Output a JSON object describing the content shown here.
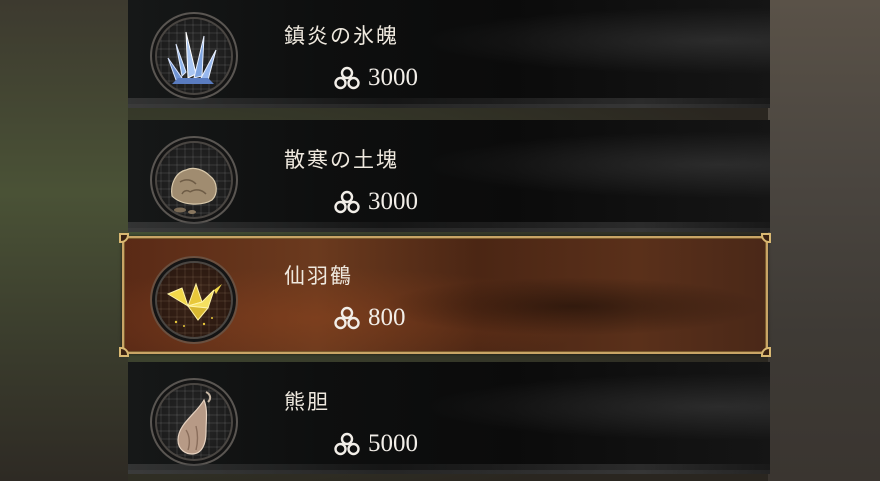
{
  "items": [
    {
      "name": "鎮炎の氷魄",
      "price": "3000",
      "icon": "ice-crystal-icon"
    },
    {
      "name": "散寒の土塊",
      "price": "3000",
      "icon": "clay-lump-icon"
    },
    {
      "name": "仙羽鶴",
      "price": "800",
      "icon": "paper-crane-icon",
      "selected": true
    },
    {
      "name": "熊胆",
      "price": "5000",
      "icon": "bear-gallbladder-icon"
    }
  ],
  "currency_icon": "coin-cluster-icon",
  "colors": {
    "selected_border": "#c9a566",
    "selected_fill": "#5a2a16",
    "row_fill": "#0e0f0f",
    "text": "#efe9df"
  }
}
